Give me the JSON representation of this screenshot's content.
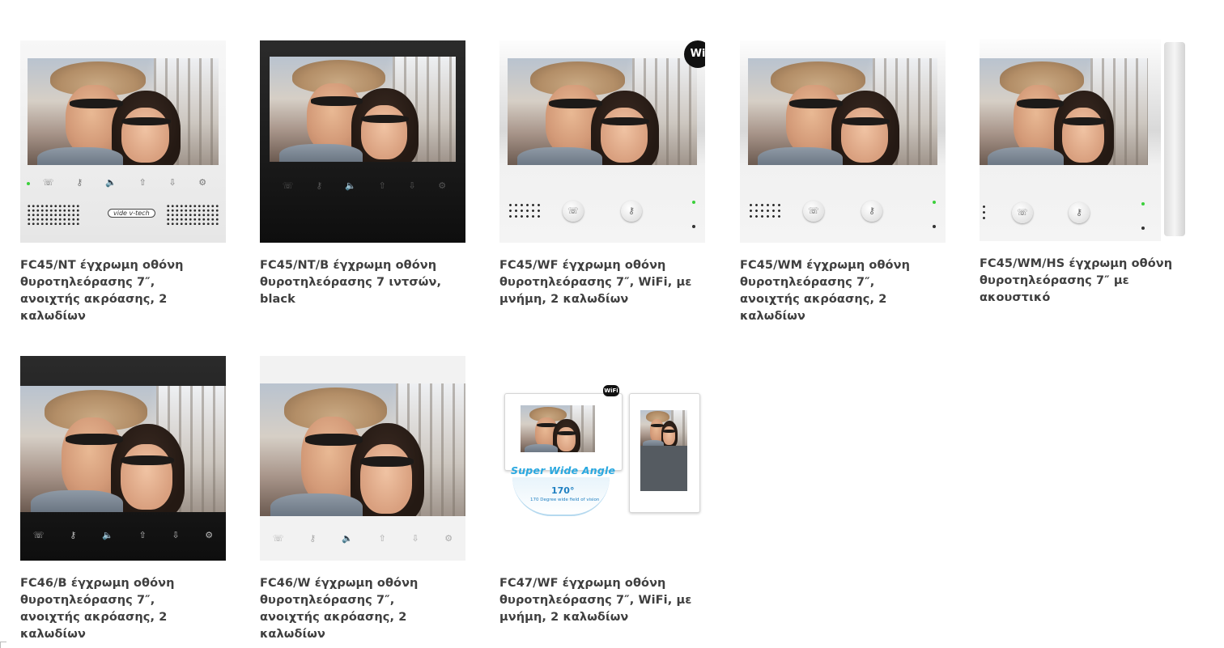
{
  "products": [
    {
      "title": "FC45/NT έγχρωμη οθόνη θυροτηλεόρασης 7″, ανοιχτής ακρόασης, 2 καλωδίων",
      "brand_label": "vide v-tech"
    },
    {
      "title": "FC45/NT/B έγχρωμη οθόνη θυροτηλεόρασης 7 ιντσών, black"
    },
    {
      "title": "FC45/WF έγχρωμη οθόνη θυροτηλεόρασης 7″, WiFi, με μνήμη, 2 καλωδίων",
      "badge": "Wi"
    },
    {
      "title": "FC45/WM έγχρωμη οθόνη θυροτηλεόρασης 7″, ανοιχτής ακρόασης, 2 καλωδίων"
    },
    {
      "title": "FC45/WM/HS έγχρωμη οθόνη θυροτηλεόρασης 7″ με ακουστικό"
    },
    {
      "title": "FC46/B έγχρωμη οθόνη θυροτηλεόρασης 7″, ανοιχτής ακρόασης, 2 καλωδίων"
    },
    {
      "title": "FC46/W έγχρωμη οθόνη θυροτηλεόρασης 7″, ανοιχτής ακρόασης, 2 καλωδίων"
    },
    {
      "title": "FC47/WF έγχρωμη οθόνη θυροτηλεόρασης 7″, WiFi, με μνήμη, 2 καλωδίων",
      "headline": "Super Wide Angle",
      "angle": "170°",
      "angle_caption": "170 Degree wide field of vision",
      "badge": "WiFi"
    }
  ],
  "icons": {
    "talk": "☏",
    "key": "⚷",
    "volume": "🔈",
    "up": "⇧",
    "down": "⇩",
    "settings": "⚙"
  },
  "colors": {
    "title_text": "#3f3f3f",
    "accent_blue": "#29a8e0",
    "led_green": "#3bd03b"
  }
}
